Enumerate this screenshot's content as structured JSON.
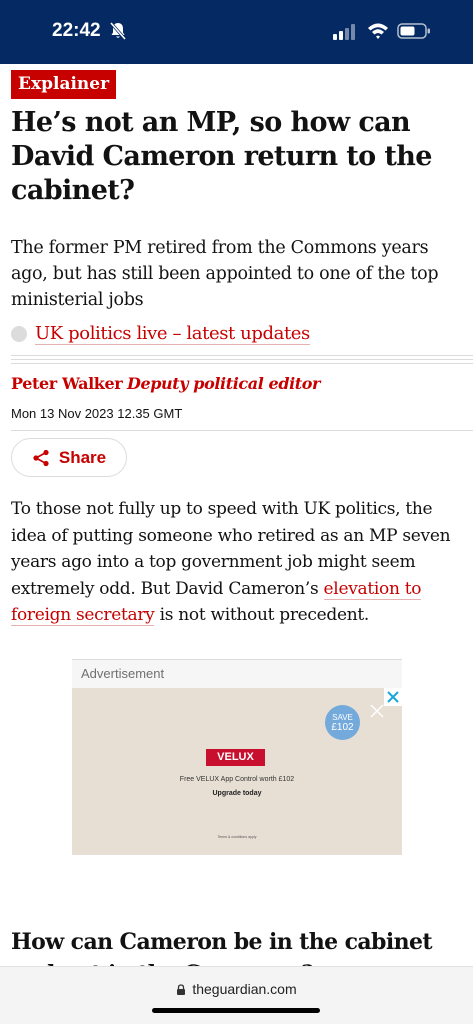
{
  "status_bar": {
    "time": "22:42",
    "icons": [
      "bell-slash-icon",
      "signal-icon",
      "wifi-icon",
      "battery-icon"
    ],
    "background": "#052962"
  },
  "article": {
    "kicker": "Explainer",
    "headline": "He’s not an MP, so how can David Cameron return to the cabinet?",
    "standfirst": "The former PM retired from the Commons years ago, but has still been appointed to one of the top ministerial jobs",
    "live_link": "UK politics live – latest updates",
    "byline": {
      "name": "Peter Walker",
      "role": "Deputy political editor"
    },
    "dateline": "Mon 13 Nov 2023 12.35 GMT",
    "share_label": "Share",
    "body": {
      "before_link": "To those not fully up to speed with UK politics, the idea of putting someone who retired as an MP seven years ago into a top government job might seem extremely odd. But David Cameron’s ",
      "link_text": "elevation to foreign secretary",
      "after_link": " is not without precedent."
    },
    "subheading": "How can Cameron be in the cabinet and not in the Commons?"
  },
  "advertisement": {
    "label": "Advertisement",
    "badge_line1": "SAVE",
    "badge_line2": "£102",
    "logo": "VELUX",
    "offer": "Free VELUX App Control worth £102",
    "cta": "Upgrade today",
    "terms": "Terms & conditions apply"
  },
  "browser": {
    "url": "theguardian.com"
  },
  "colors": {
    "accent_red": "#c70000",
    "brand_navy": "#052962",
    "text": "#121212"
  }
}
